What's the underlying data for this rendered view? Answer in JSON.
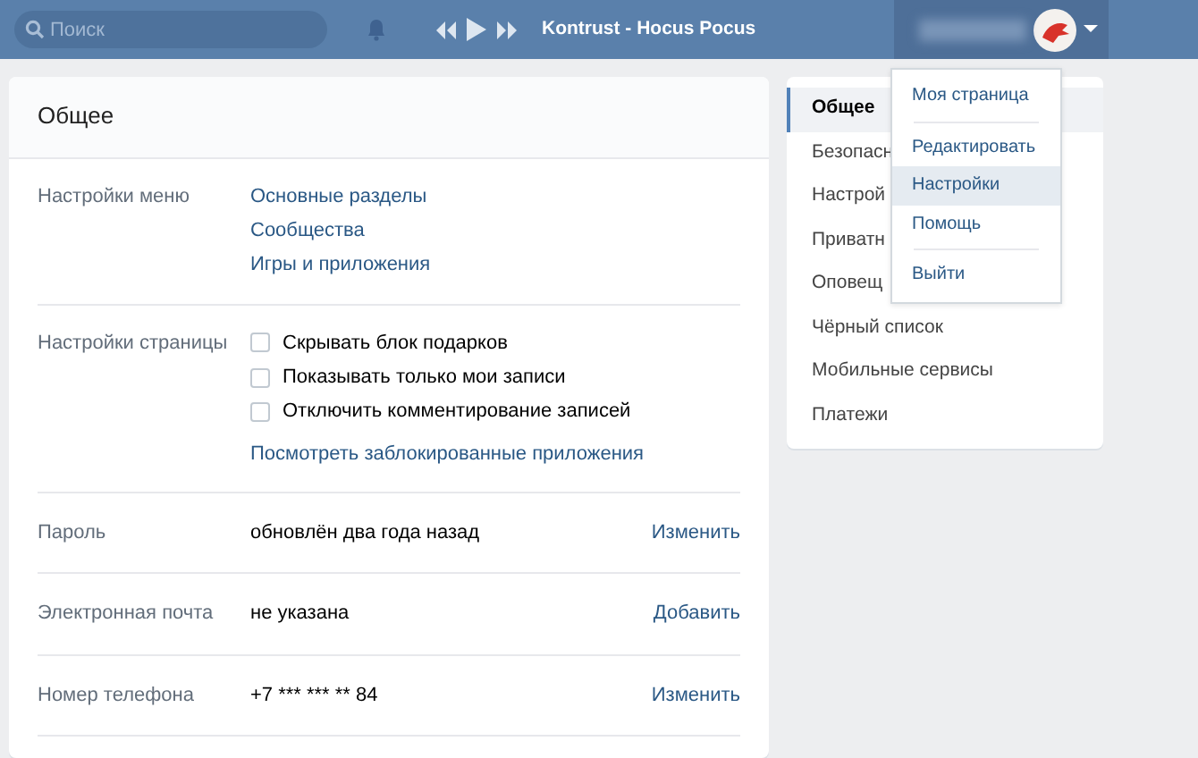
{
  "top_bar": {
    "search": {
      "placeholder": "Поиск"
    },
    "player": {
      "track": "Kontrust - Hocus Pocus"
    }
  },
  "settings": {
    "title": "Общее",
    "sections": [
      {
        "kind": "links",
        "label": "Настройки меню",
        "links": [
          "Основные разделы",
          "Сообщества",
          "Игры и приложения"
        ]
      },
      {
        "kind": "checks",
        "label": "Настройки страницы",
        "options": [
          {
            "text": "Скрывать блок подарков",
            "checked": false
          },
          {
            "text": "Показывать только мои записи",
            "checked": false
          },
          {
            "text": "Отключить комментирование записей",
            "checked": false
          }
        ],
        "link": "Посмотреть заблокированные приложения"
      },
      {
        "kind": "field",
        "label": "Пароль",
        "value": "обновлён два года назад",
        "action": "Изменить"
      },
      {
        "kind": "field",
        "label": "Электронная почта",
        "value": "не указана",
        "action": "Добавить"
      },
      {
        "kind": "field",
        "label": "Номер телефона",
        "value": "+7 *** *** ** 84",
        "action": "Изменить"
      }
    ]
  },
  "sidebar": {
    "items": [
      {
        "label": "Общее",
        "selected": true
      },
      {
        "label": "Безопасн",
        "selected": false
      },
      {
        "label": "Настрой",
        "selected": false
      },
      {
        "label": "Приватн",
        "selected": false
      },
      {
        "label": "Оповещ",
        "selected": false
      },
      {
        "label": "Чёрный список",
        "selected": false
      },
      {
        "label": "Мобильные сервисы",
        "selected": false
      },
      {
        "label": "Платежи",
        "selected": false
      }
    ]
  },
  "user_menu": {
    "groups": [
      [
        {
          "label": "Моя страница",
          "selected": false
        }
      ],
      [
        {
          "label": "Редактировать",
          "selected": false
        },
        {
          "label": "Настройки",
          "selected": true
        },
        {
          "label": "Помощь",
          "selected": false
        }
      ],
      [
        {
          "label": "Выйти",
          "selected": false
        }
      ]
    ]
  }
}
